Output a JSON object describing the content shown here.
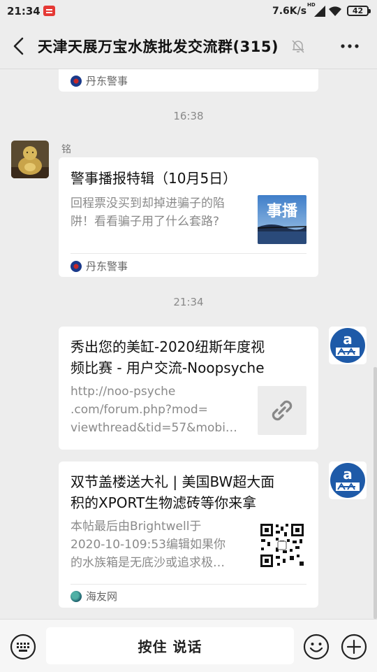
{
  "status_bar": {
    "time": "21:34",
    "network_speed": "7.6K/s",
    "network_type": "HD",
    "battery": "42",
    "icons": [
      "notification-app-icon",
      "signal-icon",
      "wifi-icon",
      "battery-icon"
    ]
  },
  "header": {
    "title": "天津天展万宝水族批发交流群(315)",
    "icons": [
      "back-icon",
      "mute-bell-icon",
      "more-icon"
    ]
  },
  "messages": [
    {
      "type": "link_card_partial",
      "source": "丹东警事"
    },
    {
      "type": "timestamp",
      "text": "16:38"
    },
    {
      "type": "link_card",
      "sender": "铭",
      "side": "left",
      "title": "警事播报特辑（10月5日）",
      "description": "回程票没买到却掉进骗子的陷阱！看看骗子用了什么套路?",
      "desc_lines": [
        "回程票没买到却掉进骗子的陷",
        "阱！看看骗子用了什么套路?"
      ],
      "thumbnail_text": "事播",
      "source": "丹东警事"
    },
    {
      "type": "timestamp",
      "text": "21:34"
    },
    {
      "type": "link_card",
      "side": "right",
      "title_lines": [
        "秀出您的美缸-2020纽斯年度视",
        "频比赛 - 用户交流-Noopsyche"
      ],
      "desc_lines": [
        "http://noo-psyche",
        ".com/forum.php?mod=",
        "viewthread&tid=57&mobi…"
      ],
      "thumbnail": "link-icon"
    },
    {
      "type": "link_card",
      "side": "right",
      "title_lines": [
        "双节盖楼送大礼 | 美国BW超大面",
        "积的XPORT生物滤砖等你来拿"
      ],
      "desc_lines": [
        "本帖最后由Brightwell于",
        "2020-10-109:53编辑如果你",
        "的水族箱是无底沙或追求极…"
      ],
      "thumbnail": "qr-code",
      "source": "海友网"
    }
  ],
  "input_bar": {
    "hold_to_talk": "按住 说话",
    "icons": [
      "keyboard-icon",
      "emoji-icon",
      "plus-icon"
    ]
  },
  "colors": {
    "background": "#ededed",
    "card": "#ffffff",
    "muted_text": "#8a8a8a"
  }
}
